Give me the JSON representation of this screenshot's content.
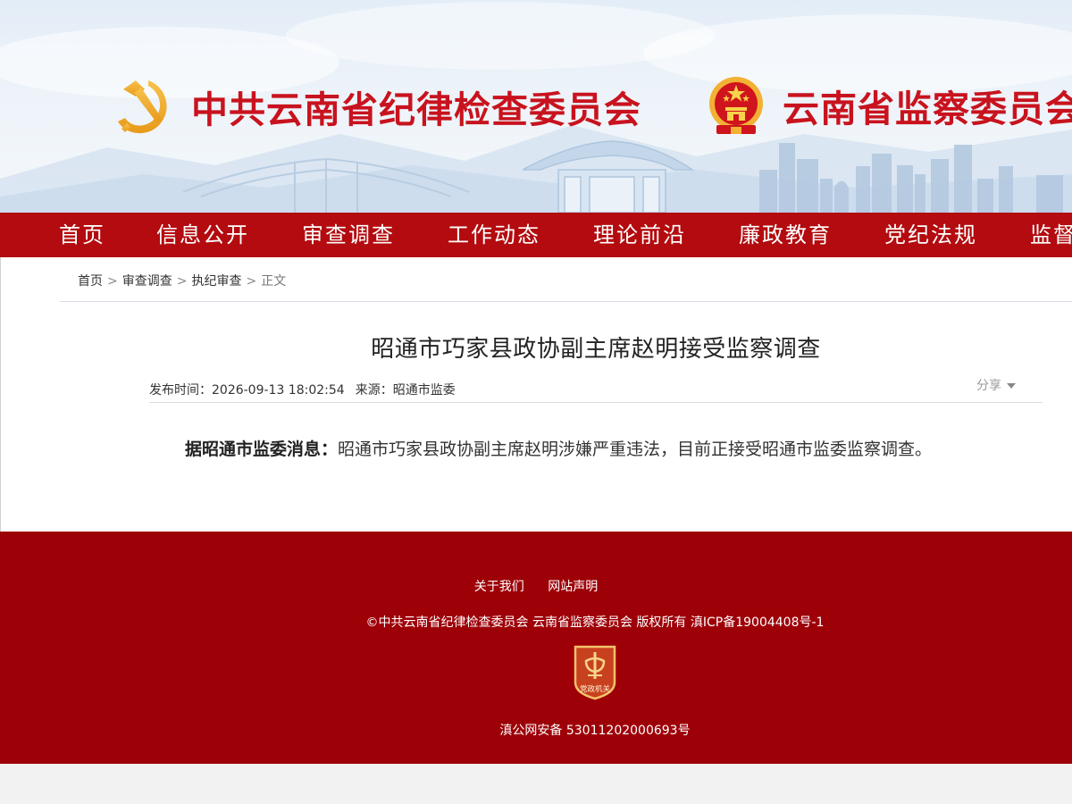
{
  "header": {
    "org1_name": "中共云南省纪律检查委员会",
    "org2_name": "云南省监察委员会"
  },
  "nav": {
    "items": [
      {
        "label": "首页"
      },
      {
        "label": "信息公开"
      },
      {
        "label": "审查调查"
      },
      {
        "label": "工作动态"
      },
      {
        "label": "理论前沿"
      },
      {
        "label": "廉政教育"
      },
      {
        "label": "党纪法规"
      },
      {
        "label": "监督"
      }
    ]
  },
  "breadcrumb": {
    "items": [
      "首页",
      "审查调查",
      "执纪审查"
    ],
    "current": "正文",
    "separator": ">"
  },
  "article": {
    "title": "昭通市巧家县政协副主席赵明接受监察调查",
    "publish_label": "发布时间：",
    "publish_time": "2026-09-13 18:02:54",
    "source_label": "来源：",
    "source": "昭通市监委",
    "share_label": "分享",
    "lead": "据昭通市监委消息：",
    "body": "昭通市巧家县政协副主席赵明涉嫌严重违法，目前正接受昭通市监委监察调查。"
  },
  "footer": {
    "links": [
      "关于我们",
      "网站声明"
    ],
    "copyright": "©中共云南省纪律检查委员会 云南省监察委员会 版权所有 滇ICP备19004408号-1",
    "badge_text": "党政机关",
    "police_record": "滇公网安备 53011202000693号"
  },
  "colors": {
    "nav_bg": "#b30b0f",
    "footer_bg": "#9e0008",
    "brand_red": "#c8131e",
    "emblem_gold": "#f2b134"
  }
}
